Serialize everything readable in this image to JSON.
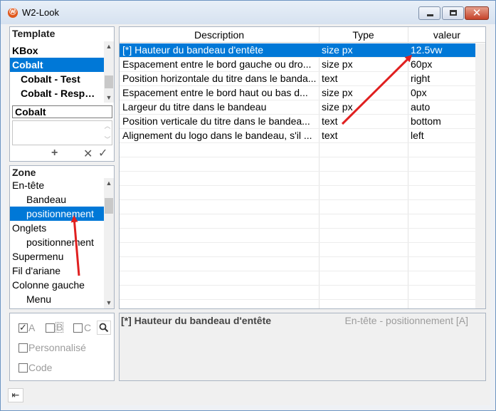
{
  "window": {
    "title": "W2-Look",
    "app_icon_glyph": "Ⓦ",
    "minimize_glyph": "",
    "close_glyph": "✕"
  },
  "template": {
    "label": "Template",
    "items": [
      {
        "label": "KBox",
        "selected": false,
        "indent": false
      },
      {
        "label": "Cobalt",
        "selected": true,
        "indent": false
      },
      {
        "label": "Cobalt - Test",
        "selected": false,
        "indent": true
      },
      {
        "label": "Cobalt - Resp…",
        "selected": false,
        "indent": true
      }
    ],
    "name_value": "Cobalt",
    "add_glyph": "+",
    "delete_glyph": "✕",
    "confirm_glyph": "✓"
  },
  "zone": {
    "label": "Zone",
    "items": [
      {
        "label": "En-tête",
        "selected": false,
        "indent": false
      },
      {
        "label": "Bandeau",
        "selected": false,
        "indent": true
      },
      {
        "label": "positionnement",
        "selected": true,
        "indent": true
      },
      {
        "label": "Onglets",
        "selected": false,
        "indent": false
      },
      {
        "label": "positionnement",
        "selected": false,
        "indent": true
      },
      {
        "label": "Supermenu",
        "selected": false,
        "indent": false
      },
      {
        "label": "Fil d'ariane",
        "selected": false,
        "indent": false
      },
      {
        "label": "Colonne gauche",
        "selected": false,
        "indent": false
      },
      {
        "label": "Menu",
        "selected": false,
        "indent": true
      }
    ]
  },
  "filters": {
    "a_label": "A",
    "b_label": "B",
    "c_label": "C",
    "custom_label": "Personnalisé",
    "code_label": "Code"
  },
  "grid": {
    "headers": {
      "description": "Description",
      "type": "Type",
      "value": "valeur"
    },
    "rows": [
      {
        "description": "[*] Hauteur du bandeau d'entête",
        "type": "size px",
        "value": "12.5vw",
        "selected": true
      },
      {
        "description": "Espacement entre le bord gauche ou dro...",
        "type": "size px",
        "value": "60px",
        "selected": false
      },
      {
        "description": "Position horizontale du titre dans le banda...",
        "type": "text",
        "value": "right",
        "selected": false
      },
      {
        "description": "Espacement entre le bord haut ou bas d...",
        "type": "size px",
        "value": "0px",
        "selected": false
      },
      {
        "description": "Largeur du titre dans le bandeau",
        "type": "size px",
        "value": "auto",
        "selected": false
      },
      {
        "description": "Position verticale du titre dans le bandea...",
        "type": "text",
        "value": "bottom",
        "selected": false
      },
      {
        "description": "Alignement du logo dans le bandeau, s'il ...",
        "type": "text",
        "value": "left",
        "selected": false
      }
    ]
  },
  "details": {
    "title": "[*] Hauteur du bandeau d'entête",
    "context": "En-tête - positionnement [A]"
  },
  "colors": {
    "selection": "#0078d7",
    "annotation_arrow": "#e02020",
    "title_bar": "#d6e2f0"
  },
  "icons": {
    "app": "w2-app-icon",
    "search": "search-icon",
    "exit": "exit-icon"
  }
}
